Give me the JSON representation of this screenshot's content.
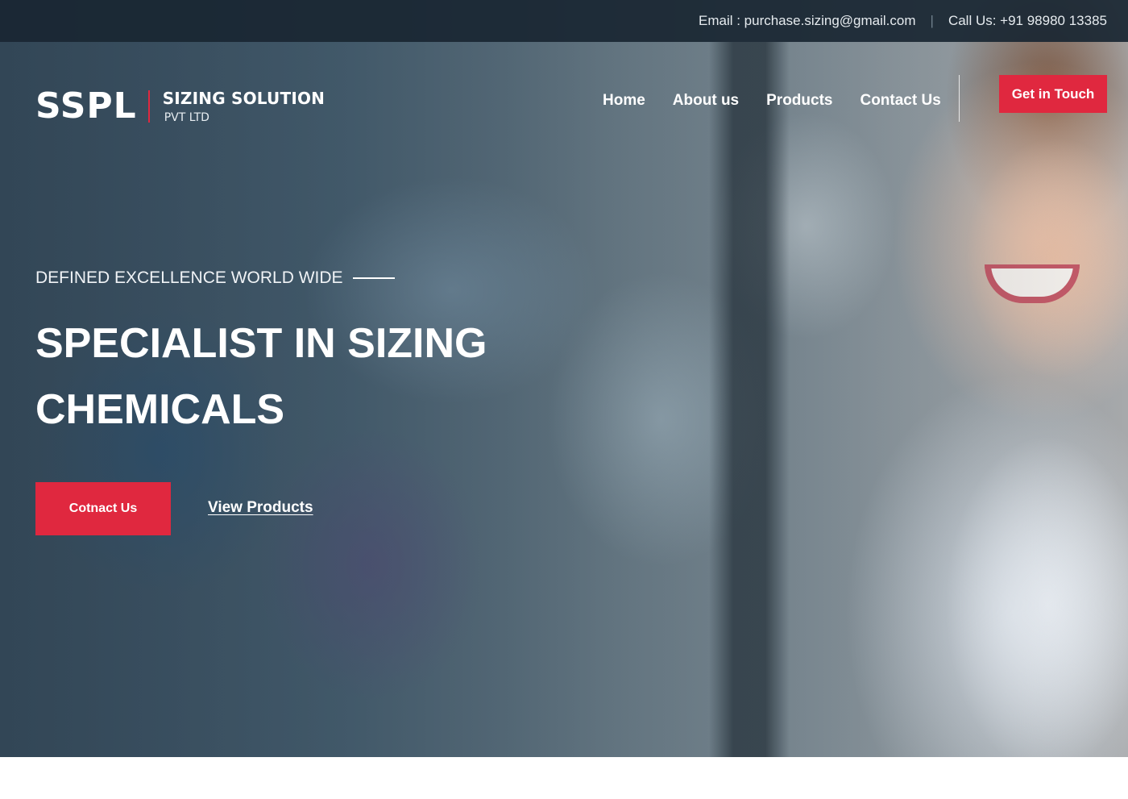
{
  "topbar": {
    "email": "Email : purchase.sizing@gmail.com",
    "separator": "|",
    "phone": "Call Us: +91 98980 13385"
  },
  "logo": {
    "mark": "SSPL",
    "name": "SIZING SOLUTION",
    "sub": "PVT LTD"
  },
  "nav": {
    "items": [
      {
        "label": "Home"
      },
      {
        "label": "About us"
      },
      {
        "label": "Products"
      },
      {
        "label": "Contact Us"
      }
    ],
    "cta": "Get in Touch"
  },
  "hero": {
    "tagline": "DEFINED EXCELLENCE WORLD WIDE",
    "headline": "SPECIALIST IN SIZING CHEMICALS",
    "primary_button": "Cotnact Us",
    "secondary_link": "View Products"
  },
  "colors": {
    "accent": "#e0283f",
    "topbar": "#192632"
  }
}
